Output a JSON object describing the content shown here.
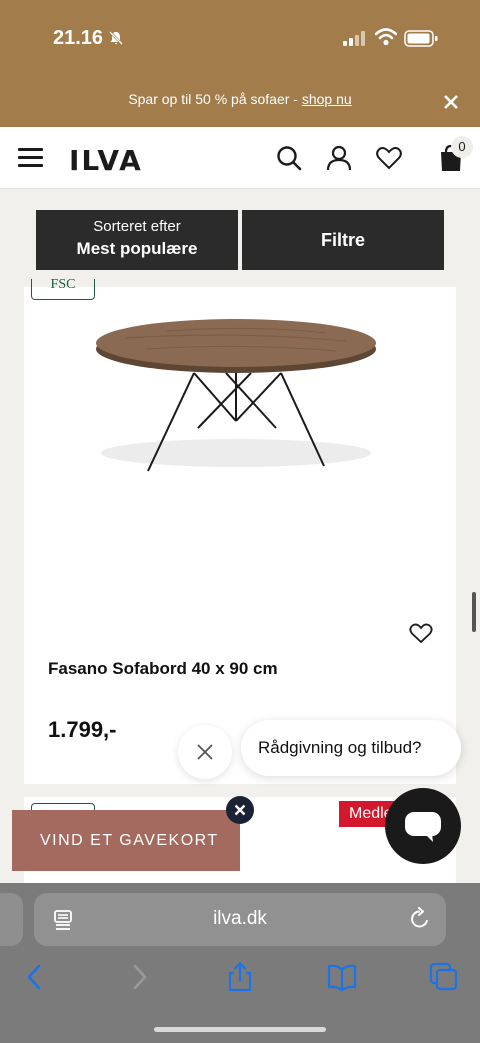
{
  "status": {
    "time": "21.16"
  },
  "promo": {
    "text": "Spar op til 50 % på sofaer - ",
    "link": "shop nu"
  },
  "header": {
    "logo": "ILVA",
    "cart_count": "0"
  },
  "sortbar": {
    "sort_label": "Sorteret efter",
    "sort_value": "Mest populære",
    "filter_label": "Filtre"
  },
  "product": {
    "badge": "FSC",
    "title": "Fasano Sofabord 40 x 90 cm",
    "price": "1.799,-"
  },
  "chat": {
    "bubble_text": "Rådgivning og tilbud?"
  },
  "product2": {
    "badge": "Medlem"
  },
  "gift": {
    "label": "VIND ET GAVEKORT"
  },
  "browser": {
    "url": "ilva.dk"
  },
  "colors": {
    "topband": "#a27c4b",
    "dark_button": "#2b2b2b",
    "gift": "#a46a60",
    "member_badge": "#d3182d"
  }
}
